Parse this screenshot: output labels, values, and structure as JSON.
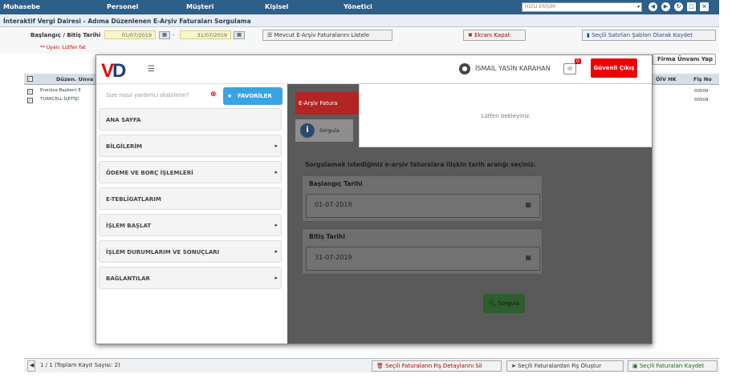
{
  "topmenu": {
    "items": [
      "Muhasebe",
      "Personel",
      "Müşteri",
      "Kişisel",
      "Yönetici"
    ],
    "quick_access_placeholder": "HIZLI ERİŞİM"
  },
  "page_title": "İnteraktif Vergi Dairesi - Adıma Düzenlenen E-Arşiv Faturaları Sorgulama",
  "filter": {
    "date_label": "Başlangıç / Bitiş Tarihi",
    "start_date": "01/07/2019",
    "end_date": "31/07/2019",
    "date_separator": "-",
    "list_button": "Mevcut E-Arşiv Faturalarını Listele",
    "close_button": "Ekranı Kapat",
    "save_template_button": "Seçili Satırları Şablon Olarak Kaydet",
    "warning": "** Uyarı: Lütfen fat",
    "firm_title_button": "Firma Ünvanı Yap"
  },
  "grid": {
    "headers": [
      "Düzen. Unva",
      "ÖİV HK",
      "Fiş No"
    ],
    "rows": [
      {
        "name": "Enerjisa Başkent E",
        "fis": "00509"
      },
      {
        "name": "TURKCELL İLETİŞİ",
        "fis": "00509"
      }
    ]
  },
  "bottom": {
    "pager": "1 / 1 (Toplam Kayıt Sayısı: 2)",
    "delete_button": "Seçili Faturaların Fiş Detaylarını Sil",
    "create_button": "Seçili Faturalardan Fiş Oluştur",
    "save_button": "Seçili Faturaları Kaydet"
  },
  "modal": {
    "user_name": "İSMAİL YASİN KARAHAN",
    "notification_count": "0",
    "logout_button": "Güvenli Çıkış",
    "help_placeholder": "Size nasıl yardımcı olabilirim?",
    "favorites_button": "FAVORİLER",
    "menu": [
      {
        "label": "ANA SAYFA",
        "arrow": ""
      },
      {
        "label": "BİLGİLERİM",
        "arrow": "▸"
      },
      {
        "label": "ÖDEME VE BORÇ İŞLEMLERİ",
        "arrow": "▸"
      },
      {
        "label": "E-TEBLİGATLARIM",
        "arrow": ""
      },
      {
        "label": "İŞLEM BAŞLAT",
        "arrow": "▸"
      },
      {
        "label": "İŞLEM DURUMLARIM VE SONUÇLARI",
        "arrow": "▸"
      },
      {
        "label": "BAĞLANTILAR",
        "arrow": "▸"
      }
    ],
    "tab_label": "E-Arşiv Fatura",
    "info_label": "Sorgula",
    "hint": "Sorgulamak istediğiniz e-arşiv faturalara ilişkin tarih aralığı seçiniz.",
    "start_label": "Başlangıç Tarihi",
    "start_value": "01-07-2019",
    "end_label": "Bitiş Tarihi",
    "end_value": "31-07-2019",
    "query_button": "Sorgula",
    "wait_text": "Lütfen bekleyiniz."
  },
  "colors": {
    "topmenu": "#2c5f8a",
    "logout": "#e00000",
    "favorites": "#3aa3e3",
    "query": "#2d5e2d"
  }
}
